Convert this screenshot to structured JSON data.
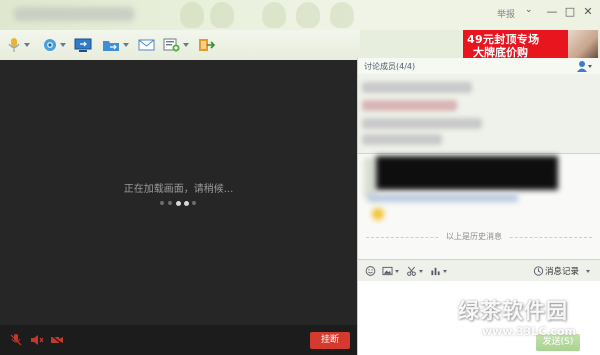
{
  "titlebar": {
    "report_label": "举报",
    "minimize_glyph": "—",
    "maximize_glyph": "□",
    "close_glyph": "✕",
    "menu_glyph": "⌄"
  },
  "toolbar": {
    "icons": [
      "microphone-icon",
      "camera-icon",
      "screen-share-icon",
      "file-transfer-icon",
      "mail-icon",
      "app-add-icon",
      "exit-icon"
    ]
  },
  "ad": {
    "line1": "49元封顶专场",
    "line2": "大牌底价购"
  },
  "video": {
    "loading_text": "正在加载画面，请稍候...",
    "dots_total": 5,
    "dots_active": [
      2,
      3
    ]
  },
  "bottombar": {
    "hangup_label": "挂断",
    "icons": [
      "mic-muted-icon",
      "speaker-muted-icon",
      "camera-off-icon"
    ]
  },
  "members": {
    "label": "讨论成员(4/4)"
  },
  "chat": {
    "history_label": "以上是历史消息"
  },
  "input_toolbar": {
    "history_button_label": "消息记录"
  },
  "send_button_label": "发送(S)",
  "watermark": {
    "name": "绿茶软件园",
    "url": "www.33LC.com"
  },
  "colors": {
    "video_bg": "#262626",
    "hangup_red": "#d43b2e",
    "ad_red": "#e8141e",
    "send_green": "#6fb449"
  }
}
